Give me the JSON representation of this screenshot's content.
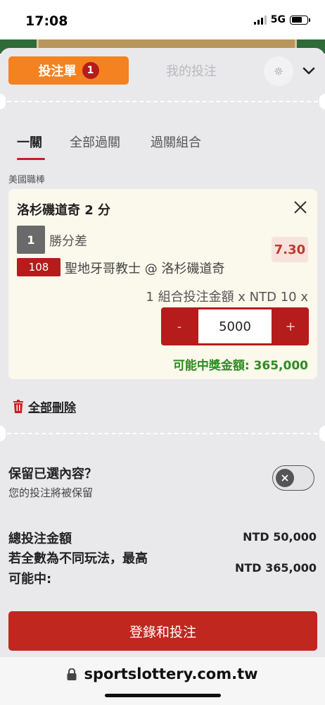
{
  "status_bar": {
    "time": "17:08",
    "network": "5G"
  },
  "tabs": {
    "betslip_label": "投注單",
    "betslip_count": "1",
    "mybets_label": "我的投注"
  },
  "mode_tabs": [
    {
      "label": "一關"
    },
    {
      "label": "全部過關"
    },
    {
      "label": "過關組合"
    }
  ],
  "league": "美國職棒",
  "bet": {
    "title": "洛杉磯道奇 2 分",
    "selection_number": "1",
    "market": "勝分差",
    "event_id": "108",
    "event": "聖地牙哥教士 @ 洛杉磯道奇",
    "odds": "7.30",
    "stake_description": "1 組合投注金額 x NTD 10 x",
    "stake": "5000",
    "minus": "-",
    "plus": "+",
    "payout": "可能中獎金額: 365,000"
  },
  "delete_all": "全部刪除",
  "keep": {
    "title": "保留已選內容？",
    "subtitle": "您的投注將被保留"
  },
  "summary": {
    "total_label": "總投注金額",
    "total_value": "NTD 50,000",
    "max_label": "若全數為不同玩法，最高可能中:",
    "max_value": "NTD 365,000"
  },
  "login_button": "登錄和投注",
  "browser": {
    "url": "sportslottery.com.tw"
  },
  "colors": {
    "accent_orange": "#f58220",
    "brand_red": "#b51c1c",
    "payout_green": "#2e8b22"
  }
}
